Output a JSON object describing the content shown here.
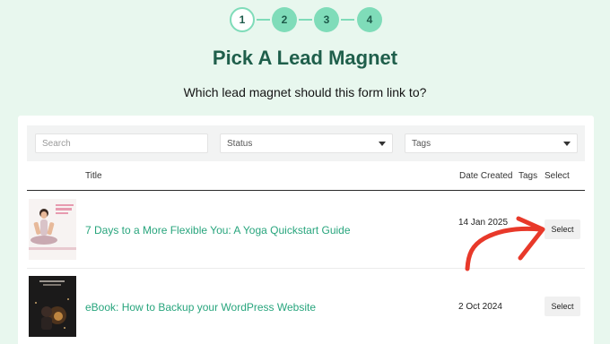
{
  "stepper": {
    "steps": [
      "1",
      "2",
      "3",
      "4"
    ],
    "active_step": 1
  },
  "header": {
    "title": "Pick A Lead Magnet",
    "subtitle": "Which lead magnet should this form link to?"
  },
  "filters": {
    "search_placeholder": "Search",
    "status_label": "Status",
    "tags_label": "Tags"
  },
  "table": {
    "columns": [
      "Title",
      "Date Created",
      "Tags",
      "Select"
    ],
    "rows": [
      {
        "title": "7 Days to a More Flexible You: A Yoga Quickstart Guide",
        "date": "14 Jan 2025",
        "tags": "",
        "select_label": "Select"
      },
      {
        "title": "eBook: How to Backup your WordPress Website",
        "date": "2 Oct 2024",
        "tags": "",
        "select_label": "Select"
      }
    ]
  },
  "colors": {
    "background": "#e8f7ee",
    "accent": "#7fdcb9",
    "title": "#1f5f4b",
    "link": "#28a57d",
    "annotation_arrow": "#e8392a"
  },
  "icons": [
    "chevron-down-icon",
    "arrow-annotation"
  ]
}
